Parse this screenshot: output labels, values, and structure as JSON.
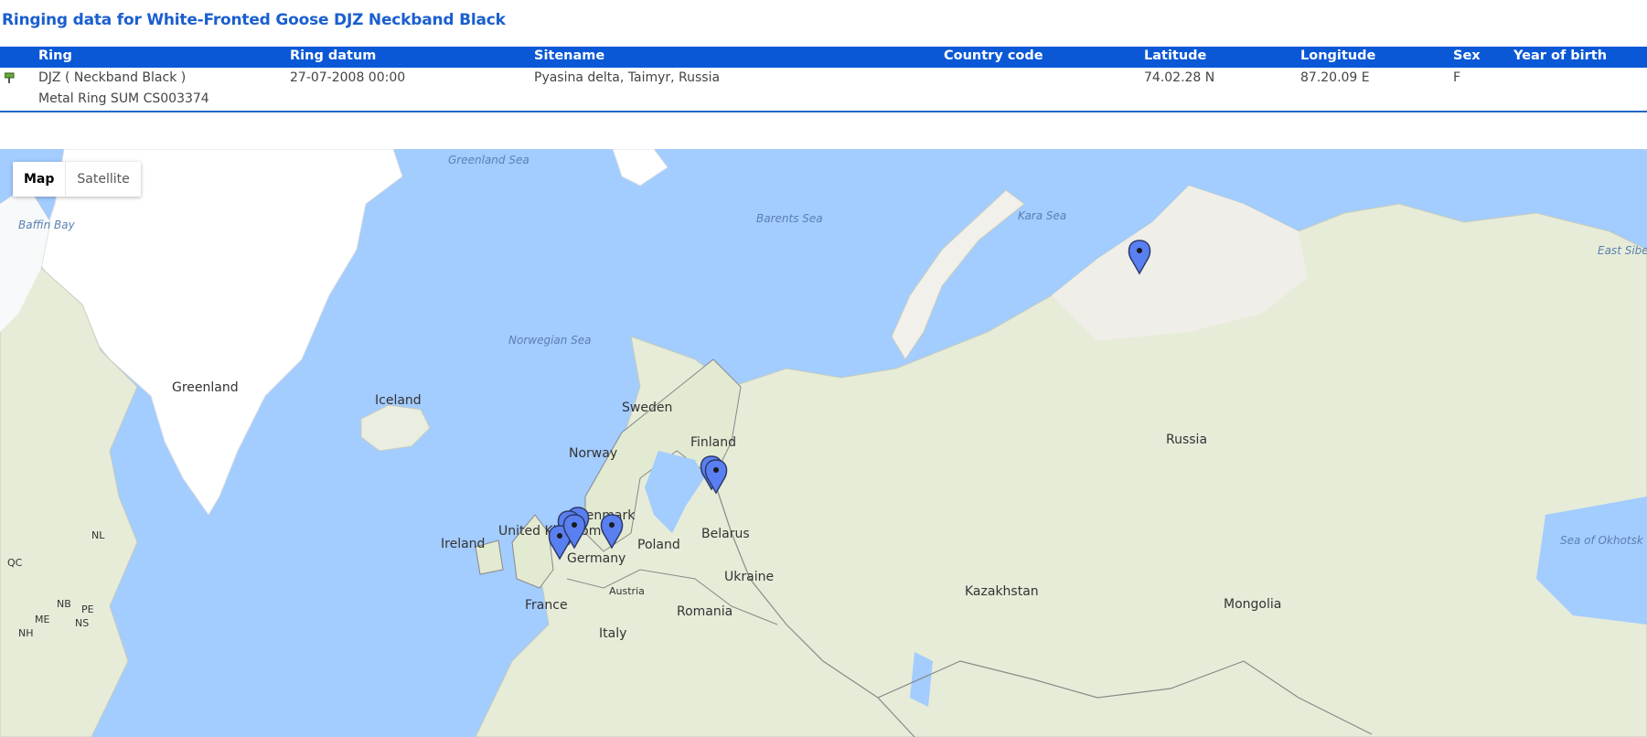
{
  "page": {
    "title": "Ringing data for White-Fronted Goose DJZ Neckband Black"
  },
  "table": {
    "headers": [
      "Ring",
      "Ring datum",
      "Sitename",
      "Country code",
      "Latitude",
      "Longitude",
      "Sex",
      "Year of birth"
    ],
    "row": {
      "ring": "DJZ ( Neckband Black )",
      "ring_datum": "27-07-2008 00:00",
      "sitename": "Pyasina delta, Taimyr, Russia",
      "country_code": "",
      "latitude": "74.02.28 N",
      "longitude": "87.20.09 E",
      "sex": "F",
      "year_of_birth": "",
      "extra_ring": "Metal Ring SUM CS003374"
    }
  },
  "map": {
    "type_buttons": [
      "Map",
      "Satellite"
    ],
    "active_type": "Map",
    "sea_labels": [
      "Greenland Sea",
      "Baffin Bay",
      "Barents Sea",
      "Kara Sea",
      "Norwegian Sea",
      "Sea of Okhotsk",
      "East Siberian"
    ],
    "land_labels": [
      "Greenland",
      "Iceland",
      "Sweden",
      "Norway",
      "Finland",
      "Russia",
      "United Kingdom",
      "Ireland",
      "Denmark",
      "Germany",
      "Poland",
      "Belarus",
      "Ukraine",
      "France",
      "Austria",
      "Romania",
      "Italy",
      "Kazakhstan",
      "Mongolia",
      "NL",
      "QC",
      "NB",
      "PE",
      "ME",
      "NS",
      "NH"
    ],
    "marker_count": 8,
    "colors": {
      "water": "#a3ccff",
      "land": "#f0eee8",
      "ice": "#ffffff",
      "marker": "#5a7ff0"
    }
  }
}
